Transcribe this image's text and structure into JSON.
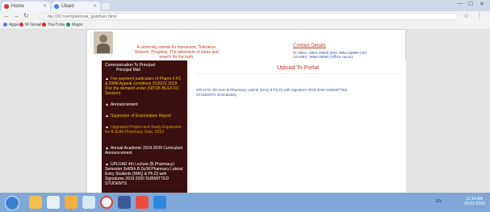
{
  "browser": {
    "tabs": [
      {
        "label": "Home",
        "fav_color": "#d33"
      },
      {
        "label": "Ubaid",
        "fav_color": "#4285f4"
      }
    ],
    "url": "file:///D:/sample/nssk_gulshan.html",
    "bookmarks": [
      {
        "label": "Apps",
        "color": "#4285f4"
      },
      {
        "label": "M Gmail",
        "color": "#d33"
      },
      {
        "label": "YouTube",
        "color": "#e62117"
      },
      {
        "label": "Maps",
        "color": "#0f9d58"
      }
    ]
  },
  "site": {
    "tagline": "A university stands for humanism, Tolerance, Reason, Progress, The adventure of ideas and search for the truth.",
    "contact": {
      "title": "Contact Details",
      "lines": [
        "M: 9954-. 9954-29880 (Mrs. 9954-29880-Chr)",
        "LD 0364 : 9954-29880 (Office Hours)"
      ]
    },
    "sidebar": {
      "heading": "Communication To Principal",
      "subheading": "Principal Mail",
      "items": [
        {
          "text": "Fee payment particulars of Pharm.F.FC & DMM Appeal conditions 2020/21 2019 (For the demand under (NITOK BULK FC Session)",
          "color": "#f0c419"
        },
        {
          "text": "Announcement",
          "color": "#ffffff"
        },
        {
          "text": "Supervisor of Examination Report",
          "color": "#f0c419"
        },
        {
          "text": "Upgraded Project and Study Expansion for B.Sc/M.Pharmacy Sept. 2019",
          "color": "#d4a017"
        },
        {
          "text": "Annual Academic 2019-2020 Curriculum Announcement",
          "color": "#ffffff"
        },
        {
          "text": "UPLOAD 4th Lecture (B.Pharmacy) Semester 3rd/5th B.Sc/M.Pharmacy Lateral Entry Students (MAQ & Ph.D) with Signatures 2019 2020 SUBMITTED STUDENTS",
          "color": "#ffffff"
        }
      ]
    },
    "main": {
      "title": "Upload To Portal",
      "text": "UPLOAD 4th Sem B.Pharmacy Lateral (MAQ & Ph.D) with Signature 2019 2020 SUBMITTED STUDENTS Immediately."
    }
  },
  "taskbar": {
    "tray": "EN",
    "time": "11:14 AM",
    "date": "25-01-2020"
  }
}
